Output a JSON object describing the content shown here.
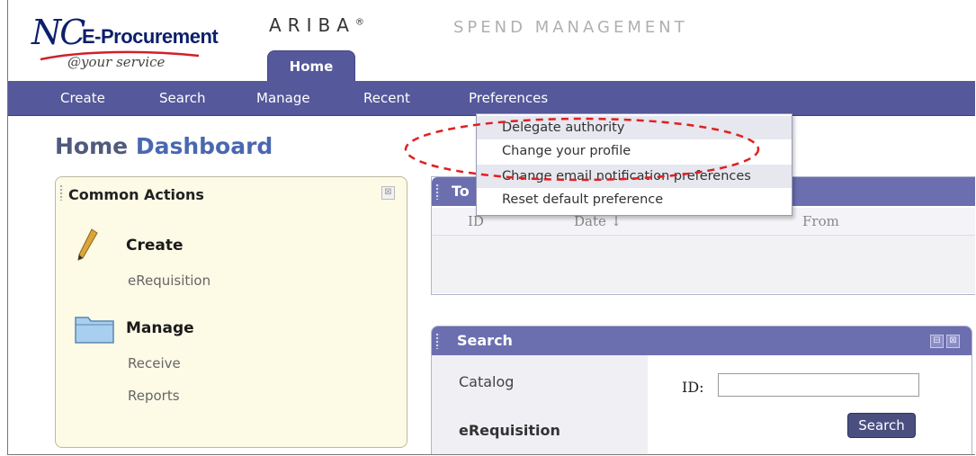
{
  "header": {
    "logo_nc": "NC",
    "logo_eprocurement": "E-Procurement",
    "logo_service": "@your service",
    "brand": "ARIBA",
    "brand_mark": "®",
    "tagline": "SPEND MANAGEMENT",
    "active_tab": "Home"
  },
  "nav": {
    "items": [
      "Create",
      "Search",
      "Manage",
      "Recent",
      "Preferences"
    ]
  },
  "preferences_menu": {
    "items": [
      "Delegate authority",
      "Change your profile",
      "Change email notification preferences",
      "Reset default preference"
    ]
  },
  "page": {
    "title_part1": "Home",
    "title_part2": "Dashboard"
  },
  "common_actions": {
    "title": "Common Actions",
    "close_glyph": "⊠",
    "create_heading": "Create",
    "create_links": [
      "eRequisition"
    ],
    "manage_heading": "Manage",
    "manage_links": [
      "Receive",
      "Reports"
    ]
  },
  "todo": {
    "title_fragment": "To",
    "columns": [
      "ID",
      "Date ↓",
      "From"
    ]
  },
  "search": {
    "title": "Search",
    "tabs": [
      "Catalog",
      "eRequisition"
    ],
    "id_label": "ID:",
    "id_value": "",
    "button_label": "Search",
    "minimize_glyph": "⊟",
    "close_glyph": "⊠"
  },
  "colors": {
    "nav_bg": "#55589a",
    "panel_header": "#6b6fb0",
    "highlight_oval": "#e02020",
    "common_actions_bg": "#fdfae6"
  }
}
